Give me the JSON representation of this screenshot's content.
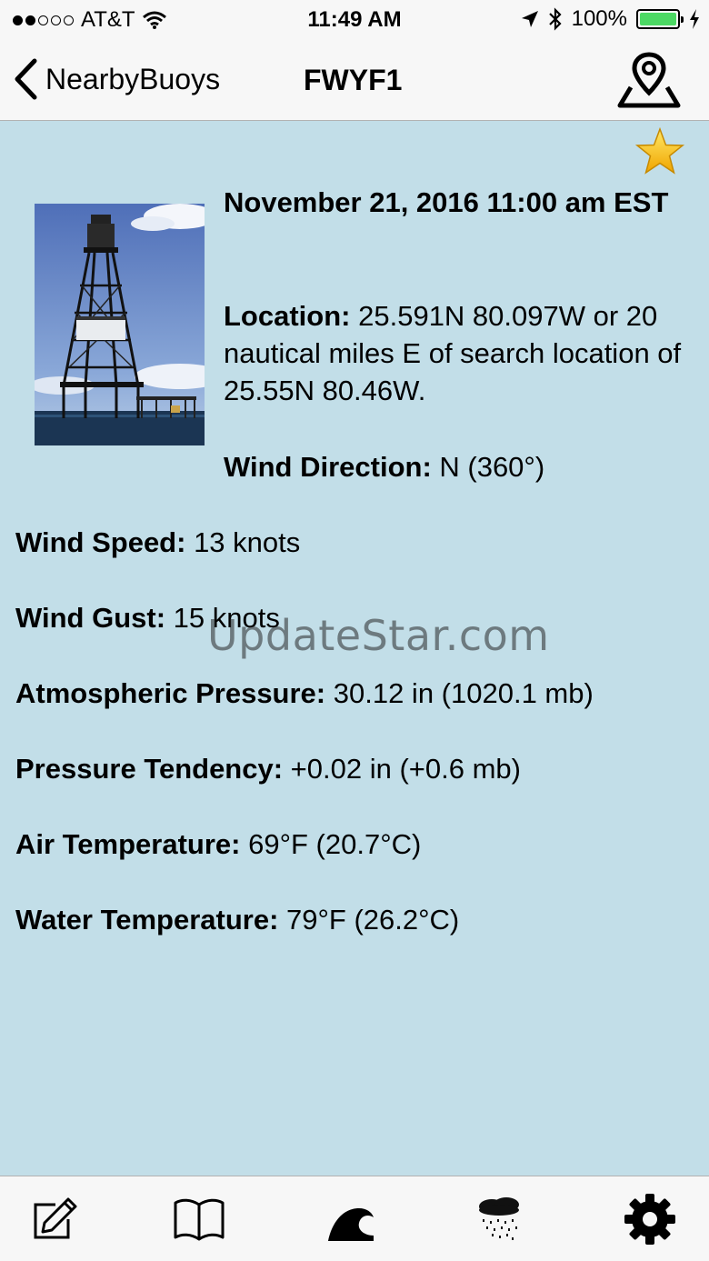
{
  "status_bar": {
    "carrier": "AT&T",
    "time": "11:49 AM",
    "battery": "100%"
  },
  "nav": {
    "back_label": "NearbyBuoys",
    "title": "FWYF1"
  },
  "observation": {
    "datetime": "November 21, 2016 11:00 am EST",
    "location_label": "Location:",
    "location_value": " 25.591N 80.097W or 20 nautical miles E of search location of 25.55N 80.46W.",
    "wind_direction_label": "Wind Direction:",
    "wind_direction_value": " N (360°)",
    "wind_speed_label": "Wind Speed:",
    "wind_speed_value": " 13 knots",
    "wind_gust_label": "Wind Gust:",
    "wind_gust_value": " 15 knots",
    "pressure_label": "Atmospheric Pressure:",
    "pressure_value": " 30.12 in (1020.1 mb)",
    "tendency_label": "Pressure Tendency:",
    "tendency_value": " +0.02 in (+0.6 mb)",
    "air_temp_label": "Air Temperature:",
    "air_temp_value": " 69°F (20.7°C)",
    "water_temp_label": "Water Temperature:",
    "water_temp_value": " 79°F (26.2°C)"
  },
  "watermark": "UpdateStar.com",
  "colors": {
    "background": "#c2dee8",
    "bar": "#f7f7f7",
    "star": "#f5c518",
    "battery": "#4cd964"
  }
}
